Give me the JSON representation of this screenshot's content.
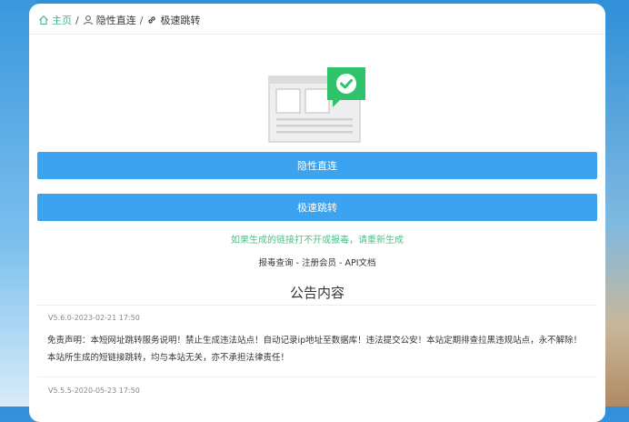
{
  "breadcrumb": {
    "home": "主页",
    "item1": "隐性直连",
    "item2": "极速跳转",
    "separator": "/"
  },
  "buttons": {
    "hidden_direct": "隐性直连",
    "fast_redirect": "极速跳转"
  },
  "hint": "如果生成的链接打不开或报毒，请重新生成",
  "links": {
    "report": "报毒查询",
    "register": "注册会员",
    "api": "API文档",
    "separator": " - "
  },
  "announcement": {
    "title": "公告内容",
    "entries": [
      {
        "version": "V5.6.0-2023-02-21 17:50",
        "line1": "免责声明：本短网址跳转服务说明！禁止生成违法站点！自动记录ip地址至数据库！违法提交公安！本站定期排查拉黑违规站点，永不解除！",
        "line2": "本站所生成的短链接跳转，均与本站无关，亦不承担法律责任！"
      },
      {
        "version": "V5.5.5-2020-05-23 17:50"
      }
    ]
  },
  "colors": {
    "primary_button": "#3ba3f0",
    "hint_green": "#4fbf88",
    "check_green": "#2fc46b",
    "home_green": "#3fb38a"
  },
  "icons": {
    "home": "home-icon",
    "user": "user-icon",
    "link": "link-icon",
    "illustration": "webpage-check-illustration"
  }
}
